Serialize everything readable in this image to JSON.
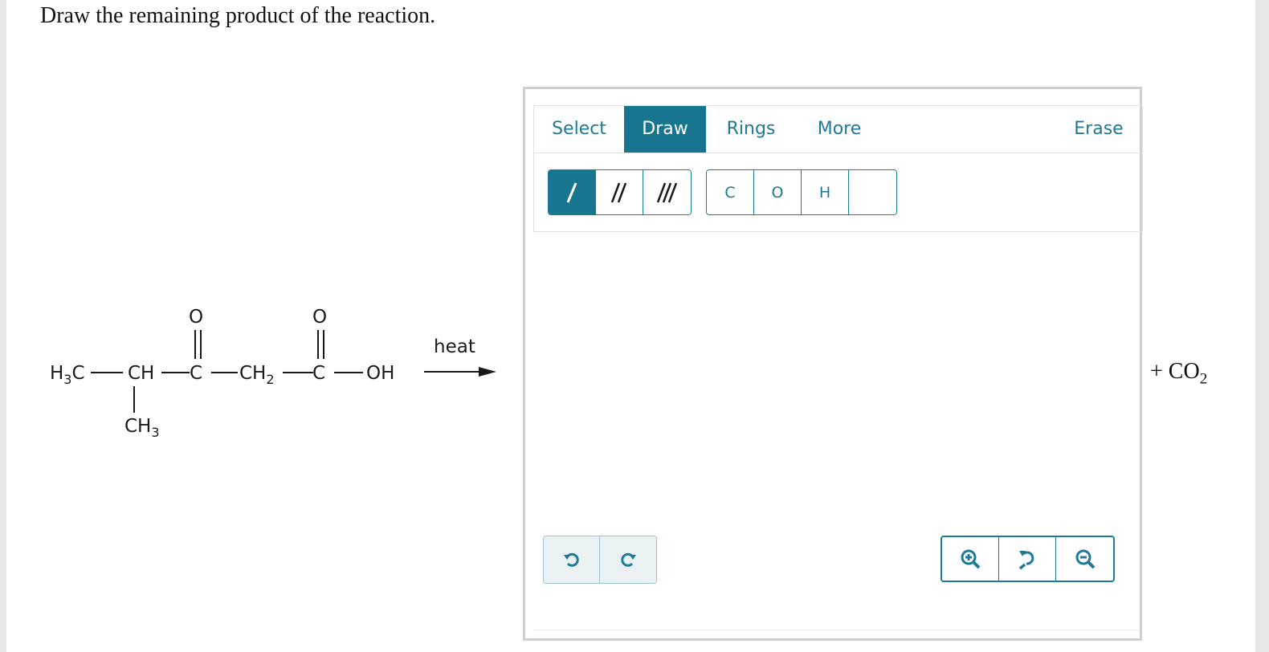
{
  "question": {
    "prompt": "Draw the remaining product of the reaction."
  },
  "reactant": {
    "h3c": "H3C",
    "ch": "CH",
    "c1": "C",
    "ch2": "CH2",
    "c2": "C",
    "oh": "OH",
    "o1": "O",
    "o2": "O",
    "ch3": "CH3"
  },
  "reaction": {
    "condition": "heat"
  },
  "editor": {
    "tabs": {
      "select": "Select",
      "draw": "Draw",
      "rings": "Rings",
      "more": "More",
      "erase": "Erase"
    },
    "atoms": {
      "carbon": "C",
      "oxygen": "O",
      "hydrogen": "H"
    },
    "accent_color": "#17758f"
  },
  "byproduct": {
    "plus": "+ CO",
    "subscript": "2"
  }
}
